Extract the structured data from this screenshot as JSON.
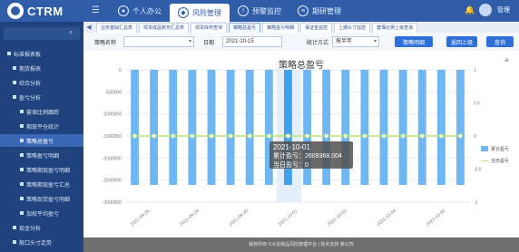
{
  "app": {
    "name": "CTRM",
    "user": "管理"
  },
  "topnav": [
    {
      "label": "个人办公",
      "icon": "person-icon"
    },
    {
      "label": "风险管理",
      "icon": "shield-icon"
    },
    {
      "label": "预警监控",
      "icon": "alert-icon"
    },
    {
      "label": "期研管理",
      "icon": "document-icon"
    }
  ],
  "sidebar": [
    {
      "label": "标准报表板",
      "level": 0
    },
    {
      "label": "期货报表",
      "level": 1
    },
    {
      "label": "综合分析",
      "level": 1
    },
    {
      "label": "盈亏分析",
      "level": 1
    },
    {
      "label": "套保比例跟踪",
      "level": 2
    },
    {
      "label": "期现平仓统计",
      "level": 2
    },
    {
      "label": "策略总盈亏",
      "level": 2,
      "active": true
    },
    {
      "label": "策略盈亏明细",
      "level": 2
    },
    {
      "label": "策略期现盈亏明细",
      "level": 2
    },
    {
      "label": "策略期现盈亏汇总",
      "level": 2
    },
    {
      "label": "策略现货盈亏明细",
      "level": 2
    },
    {
      "label": "加权平均盈亏",
      "level": 2
    },
    {
      "label": "现金分析",
      "level": 1
    },
    {
      "label": "敞口头寸走势",
      "level": 1
    }
  ],
  "tabs": [
    "业务基础汇总表",
    "现货成品账务汇总表",
    "现货库存查询",
    "策略总盈亏",
    "策略盈亏明细",
    "保证金监控",
    "上期头寸监控",
    "套保比例上级查询"
  ],
  "toolbar": {
    "strategy_label": "策略名称",
    "strategy_value": "",
    "date_label": "日期",
    "date_value": "2021-10-15",
    "stat_label": "统计方式",
    "stat_value": "按半年",
    "query_button": "策略明细",
    "btn2": "返回上级",
    "btn3": "查询"
  },
  "chart_data": {
    "type": "bar",
    "title": "策略总盈亏",
    "categories": [
      "2021-09-26",
      "2021-09-29",
      "2021-09-30",
      "2021-10-01",
      "2021-10-02",
      "2021-10-04",
      "2021-10-05"
    ],
    "ylim": [
      -3000000,
      0
    ],
    "yticks": [
      0,
      -500000,
      -1000000,
      -1500000,
      -2000000,
      -2500000,
      -3000000
    ],
    "y2lim": [
      -1,
      1
    ],
    "y2ticks": [
      1,
      0.5,
      0,
      -0.5,
      -1
    ],
    "series": [
      {
        "name": "累计盈亏",
        "type": "bar",
        "color": "#6fb7f2",
        "values": [
          -2609368,
          -2609368,
          -2609368,
          -2609368,
          -2609368,
          -2609368,
          -2609368,
          -2609368,
          -2609368,
          -2609368,
          -2609368,
          -2609368,
          -2609368,
          -2609368,
          -2609368,
          -2609368,
          -2609368,
          -2609368
        ]
      },
      {
        "name": "当日盈亏",
        "type": "line",
        "color": "#b7e47a",
        "values": [
          0,
          0,
          0,
          0,
          0,
          0,
          0,
          0,
          0,
          0,
          0,
          0,
          0,
          0,
          0,
          0,
          0,
          0
        ]
      }
    ],
    "tooltip": {
      "date": "2021-10-01",
      "line1": "累计盈亏：2609368.004",
      "line2": "当日盈亏：0"
    }
  },
  "footer": "版权所有 ©大宗商品风险管理平台 | 技术支持 某公司"
}
